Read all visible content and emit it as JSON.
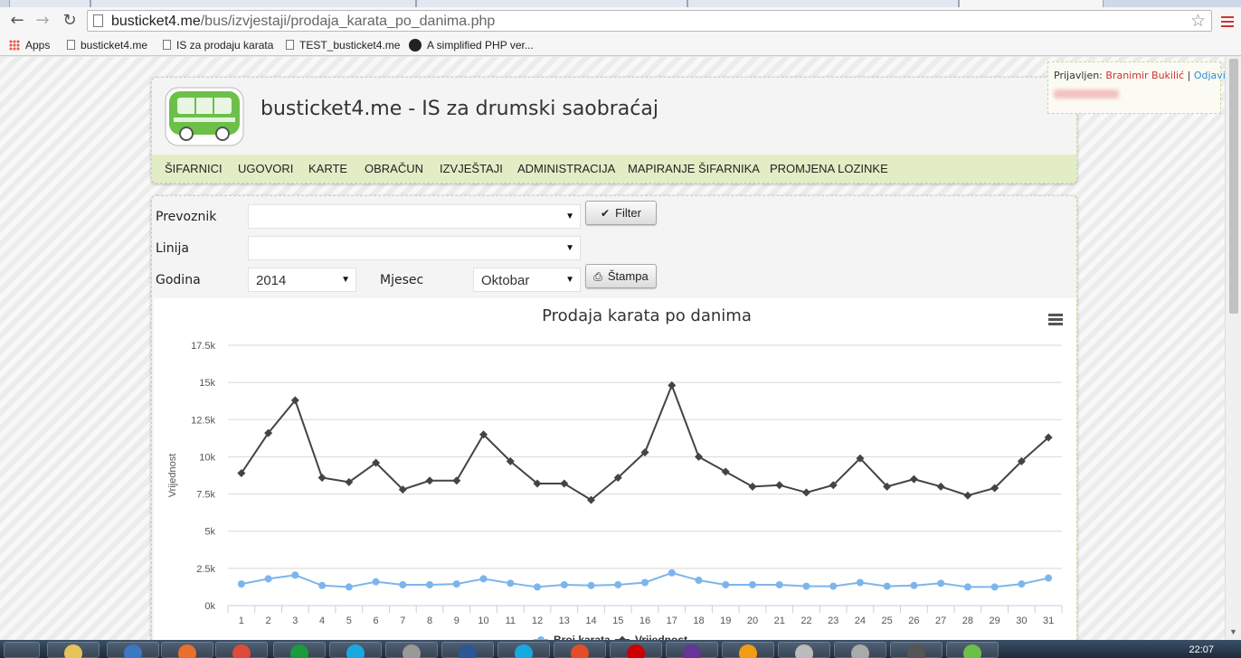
{
  "browser": {
    "url_host": "busticket4.me",
    "url_path": "/bus/izvjestaji/prodaja_karata_po_danima.php",
    "bookmarks": [
      "Apps",
      "busticket4.me",
      "IS za prodaju karata",
      "TEST_busticket4.me",
      "A simplified PHP ver..."
    ]
  },
  "header": {
    "title": "busticket4.me - IS za drumski saobraćaj",
    "nav": [
      "ŠIFARNICI",
      "UGOVORI",
      "KARTE",
      "OBRAČUN",
      "IZVJEŠTAJI",
      "ADMINISTRACIJA",
      "MAPIRANJE ŠIFARNIKA",
      "PROMJENA LOZINKE"
    ]
  },
  "user": {
    "prefix": "Prijavljen:",
    "name": "Branimir Bukilić",
    "separator": "|",
    "logout": "Odjavi se"
  },
  "filters": {
    "carrier_label": "Prevoznik",
    "carrier_value": "",
    "line_label": "Linija",
    "line_value": "",
    "year_label": "Godina",
    "year_value": "2014",
    "month_label": "Mjesec",
    "month_value": "Oktobar",
    "filter_button": "Filter",
    "print_button": "Štampa"
  },
  "chart_data": {
    "type": "line",
    "title": "Prodaja karata po danima",
    "xlabel": "",
    "ylabel": "Vrijednost",
    "ylim": [
      0,
      17500
    ],
    "yticks": [
      "0k",
      "2.5k",
      "5k",
      "7.5k",
      "10k",
      "12.5k",
      "15k",
      "17.5k"
    ],
    "x": [
      1,
      2,
      3,
      4,
      5,
      6,
      7,
      8,
      9,
      10,
      11,
      12,
      13,
      14,
      15,
      16,
      17,
      18,
      19,
      20,
      21,
      22,
      23,
      24,
      25,
      26,
      27,
      28,
      29,
      30,
      31
    ],
    "grid": true,
    "legend_placement": "bottom",
    "series": [
      {
        "name": "Broj karata",
        "color": "#7cb5ec",
        "values": [
          1450,
          1800,
          2050,
          1350,
          1250,
          1600,
          1400,
          1400,
          1450,
          1800,
          1500,
          1250,
          1400,
          1350,
          1400,
          1550,
          2200,
          1700,
          1400,
          1400,
          1400,
          1300,
          1300,
          1550,
          1300,
          1350,
          1500,
          1250,
          1250,
          1450,
          1850
        ]
      },
      {
        "name": "Vrijednost",
        "color": "#434348",
        "values": [
          8900,
          11600,
          13800,
          8600,
          8300,
          9600,
          7800,
          8400,
          8400,
          11500,
          9700,
          8200,
          8200,
          7100,
          8600,
          10300,
          14800,
          10000,
          9000,
          8000,
          8100,
          7600,
          8100,
          9900,
          8000,
          8500,
          8000,
          7400,
          7900,
          9700,
          11300
        ]
      }
    ]
  },
  "taskbar": {
    "clock": "22:07"
  }
}
